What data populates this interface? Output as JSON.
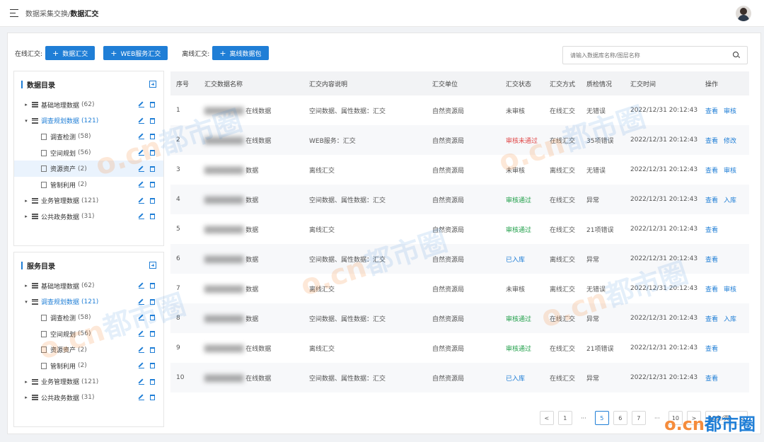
{
  "header": {
    "breadcrumb_parent": "数据采集交换/",
    "breadcrumb_current": "数据汇交"
  },
  "toolbar": {
    "online_label": "在线汇交:",
    "btn_data": "数据汇交",
    "btn_web": "WEB服务汇交",
    "offline_label": "离线汇交:",
    "btn_offline": "离线数据包",
    "search_placeholder": "请输入数据库名称/图层名称"
  },
  "data_catalog": {
    "title": "数据目录",
    "nodes": [
      {
        "name": "基础地理数据",
        "count": "(62)"
      },
      {
        "name": "调查规划数据",
        "count": "(121)"
      },
      {
        "name": "调查检测",
        "count": "(58)"
      },
      {
        "name": "空间规划",
        "count": "(56)"
      },
      {
        "name": "资源资产",
        "count": "(2)"
      },
      {
        "name": "管制利用",
        "count": "(2)"
      },
      {
        "name": "业务管理数据",
        "count": "(121)"
      },
      {
        "name": "公共政务数据",
        "count": "(31)"
      }
    ]
  },
  "service_catalog": {
    "title": "服务目录",
    "nodes": [
      {
        "name": "基础地理数据",
        "count": "(62)"
      },
      {
        "name": "调查规划数据",
        "count": "(121)"
      },
      {
        "name": "调查检测",
        "count": "(58)"
      },
      {
        "name": "空间规划",
        "count": "(56)"
      },
      {
        "name": "资源资产",
        "count": "(2)"
      },
      {
        "name": "管制利用",
        "count": "(2)"
      },
      {
        "name": "业务管理数据",
        "count": "(121)"
      },
      {
        "name": "公共政务数据",
        "count": "(31)"
      }
    ]
  },
  "table": {
    "headers": [
      "序号",
      "汇交数据名称",
      "汇交内容说明",
      "汇交单位",
      "汇交状态",
      "汇交方式",
      "质检情况",
      "汇交时间",
      "操作"
    ],
    "rows": [
      {
        "no": "1",
        "name": "在线数据",
        "desc": "空间数据、属性数据：汇交",
        "unit": "自然资源局",
        "status": "未审核",
        "status_color": "#555555",
        "method": "在线汇交",
        "qc": "无错误",
        "time": "2022/12/31 20:12:43",
        "op1": "查看",
        "op2": "审核"
      },
      {
        "no": "2",
        "name": "在线数据",
        "desc": "WEB服务：汇交",
        "unit": "自然资源局",
        "status": "审核未通过",
        "status_color": "#e04848",
        "method": "在线汇交",
        "qc": "35项错误",
        "time": "2022/12/31 20:12:43",
        "op1": "查看",
        "op2": "修改"
      },
      {
        "no": "3",
        "name": "数据",
        "desc": "离线汇交",
        "unit": "自然资源局",
        "status": "未审核",
        "status_color": "#555555",
        "method": "离线汇交",
        "qc": "无错误",
        "time": "2022/12/31 20:12:43",
        "op1": "查看",
        "op2": "审核"
      },
      {
        "no": "4",
        "name": "数据",
        "desc": "空间数据、属性数据：汇交",
        "unit": "自然资源局",
        "status": "审核通过",
        "status_color": "#22a04b",
        "method": "在线汇交",
        "qc": "异常",
        "time": "2022/12/31 20:12:43",
        "op1": "查看",
        "op2": "入库"
      },
      {
        "no": "5",
        "name": "数据",
        "desc": "离线汇交",
        "unit": "自然资源局",
        "status": "审核通过",
        "status_color": "#22a04b",
        "method": "在线汇交",
        "qc": "21项错误",
        "time": "2022/12/31 20:12:43",
        "op1": "查看",
        "op2": ""
      },
      {
        "no": "6",
        "name": "数据",
        "desc": "空间数据、属性数据：汇交",
        "unit": "自然资源局",
        "status": "已入库",
        "status_color": "#1f7ed6",
        "method": "离线汇交",
        "qc": "异常",
        "time": "2022/12/31 20:12:43",
        "op1": "查看",
        "op2": ""
      },
      {
        "no": "7",
        "name": "数据",
        "desc": "离线汇交",
        "unit": "自然资源局",
        "status": "未审核",
        "status_color": "#555555",
        "method": "离线汇交",
        "qc": "无错误",
        "time": "2022/12/31 20:12:43",
        "op1": "查看",
        "op2": "审核"
      },
      {
        "no": "8",
        "name": "数据",
        "desc": "空间数据、属性数据：汇交",
        "unit": "自然资源局",
        "status": "审核通过",
        "status_color": "#22a04b",
        "method": "在线汇交",
        "qc": "异常",
        "time": "2022/12/31 20:12:43",
        "op1": "查看",
        "op2": "入库"
      },
      {
        "no": "9",
        "name": "在线数据",
        "desc": "离线汇交",
        "unit": "自然资源局",
        "status": "审核通过",
        "status_color": "#22a04b",
        "method": "在线汇交",
        "qc": "21项错误",
        "time": "2022/12/31 20:12:43",
        "op1": "查看",
        "op2": ""
      },
      {
        "no": "10",
        "name": "在线数据",
        "desc": "空间数据、属性数据：汇交",
        "unit": "自然资源局",
        "status": "已入库",
        "status_color": "#1f7ed6",
        "method": "在线汇交",
        "qc": "异常",
        "time": "2022/12/31 20:12:43",
        "op1": "查看",
        "op2": ""
      }
    ]
  },
  "pagination": {
    "pages": [
      "1",
      "5",
      "6",
      "7",
      "10"
    ],
    "current": "5",
    "page_size": "10条/页"
  },
  "watermark": "都市圈"
}
